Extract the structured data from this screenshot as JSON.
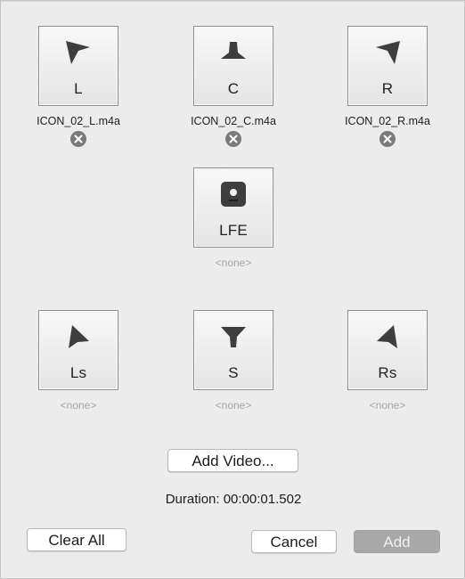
{
  "channels": {
    "L": {
      "label": "L",
      "file": "ICON_02_L.m4a",
      "icon": "speaker-front-left-icon"
    },
    "C": {
      "label": "C",
      "file": "ICON_02_C.m4a",
      "icon": "speaker-center-icon"
    },
    "R": {
      "label": "R",
      "file": "ICON_02_R.m4a",
      "icon": "speaker-front-right-icon"
    },
    "LFE": {
      "label": "LFE",
      "file": "<none>",
      "icon": "subwoofer-icon"
    },
    "Ls": {
      "label": "Ls",
      "file": "<none>",
      "icon": "speaker-surround-left-icon"
    },
    "S": {
      "label": "S",
      "file": "<none>",
      "icon": "speaker-surround-icon"
    },
    "Rs": {
      "label": "Rs",
      "file": "<none>",
      "icon": "speaker-surround-right-icon"
    }
  },
  "buttons": {
    "add_video": "Add Video...",
    "clear_all": "Clear All",
    "cancel": "Cancel",
    "add": "Add"
  },
  "duration": "Duration: 00:00:01.502",
  "colors": {
    "background": "#ececec",
    "icon": "#3e3e3e",
    "remove_icon": "#7b7b7b",
    "disabled_button": "#a8a8a8"
  }
}
